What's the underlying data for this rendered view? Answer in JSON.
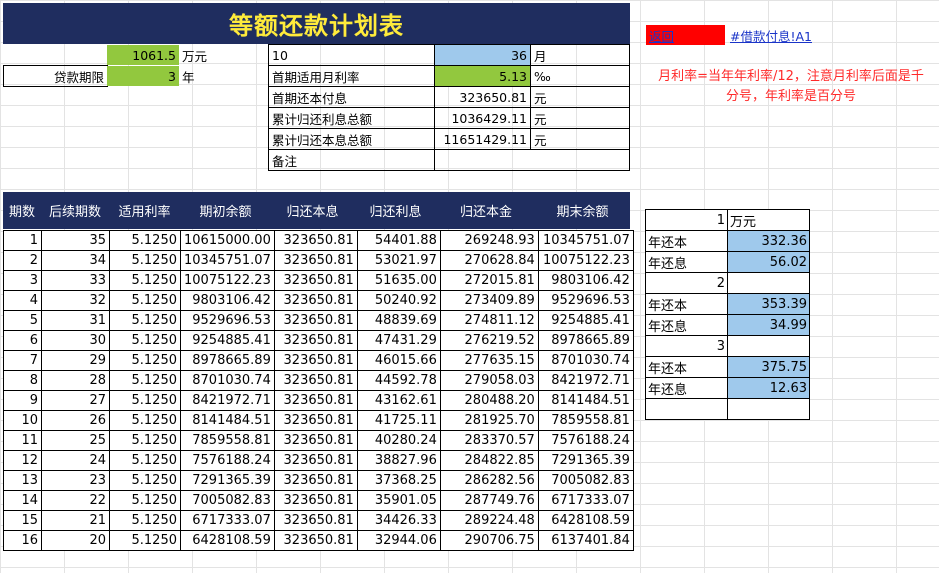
{
  "title": "等额还款计划表",
  "summary": {
    "loan_amount": "1061.5",
    "loan_unit": "万元",
    "term_label": "贷款期限",
    "term_value": "3",
    "term_unit": "年",
    "c10": "10",
    "months_value": "36",
    "months_unit": "月",
    "rate_label": "首期适用月利率",
    "rate_value": "5.13",
    "rate_unit": "‰",
    "first_payment_label": "首期还本付息",
    "first_payment_value": "323650.81",
    "yuan": "元",
    "cum_interest_label": "累计归还利息总额",
    "cum_interest_value": "1036429.11",
    "cum_total_label": "累计归还本息总额",
    "cum_total_value": "11651429.11",
    "remark_label": "备注"
  },
  "links": {
    "back_label": "返回",
    "sheet_link": "#借款付息!A1"
  },
  "note": {
    "line1": "月利率=当年年利率/12，注意月利率后面是千",
    "line2": "分号，年利率是百分号"
  },
  "table": {
    "headers": [
      "期数",
      "后续期数",
      "适用利率",
      "期初余额",
      "归还本息",
      "归还利息",
      "归还本金",
      "期末余额"
    ],
    "rows": [
      [
        "1",
        "35",
        "5.1250",
        "10615000.00",
        "323650.81",
        "54401.88",
        "269248.93",
        "10345751.07"
      ],
      [
        "2",
        "34",
        "5.1250",
        "10345751.07",
        "323650.81",
        "53021.97",
        "270628.84",
        "10075122.23"
      ],
      [
        "3",
        "33",
        "5.1250",
        "10075122.23",
        "323650.81",
        "51635.00",
        "272015.81",
        "9803106.42"
      ],
      [
        "4",
        "32",
        "5.1250",
        "9803106.42",
        "323650.81",
        "50240.92",
        "273409.89",
        "9529696.53"
      ],
      [
        "5",
        "31",
        "5.1250",
        "9529696.53",
        "323650.81",
        "48839.69",
        "274811.12",
        "9254885.41"
      ],
      [
        "6",
        "30",
        "5.1250",
        "9254885.41",
        "323650.81",
        "47431.29",
        "276219.52",
        "8978665.89"
      ],
      [
        "7",
        "29",
        "5.1250",
        "8978665.89",
        "323650.81",
        "46015.66",
        "277635.15",
        "8701030.74"
      ],
      [
        "8",
        "28",
        "5.1250",
        "8701030.74",
        "323650.81",
        "44592.78",
        "279058.03",
        "8421972.71"
      ],
      [
        "9",
        "27",
        "5.1250",
        "8421972.71",
        "323650.81",
        "43162.61",
        "280488.20",
        "8141484.51"
      ],
      [
        "10",
        "26",
        "5.1250",
        "8141484.51",
        "323650.81",
        "41725.11",
        "281925.70",
        "7859558.81"
      ],
      [
        "11",
        "25",
        "5.1250",
        "7859558.81",
        "323650.81",
        "40280.24",
        "283370.57",
        "7576188.24"
      ],
      [
        "12",
        "24",
        "5.1250",
        "7576188.24",
        "323650.81",
        "38827.96",
        "284822.85",
        "7291365.39"
      ],
      [
        "13",
        "23",
        "5.1250",
        "7291365.39",
        "323650.81",
        "37368.25",
        "286282.56",
        "7005082.83"
      ],
      [
        "14",
        "22",
        "5.1250",
        "7005082.83",
        "323650.81",
        "35901.05",
        "287749.76",
        "6717333.07"
      ],
      [
        "15",
        "21",
        "5.1250",
        "6717333.07",
        "323650.81",
        "34426.33",
        "289224.48",
        "6428108.59"
      ],
      [
        "16",
        "20",
        "5.1250",
        "6428108.59",
        "323650.81",
        "32944.06",
        "290706.75",
        "6137401.84"
      ]
    ]
  },
  "side": {
    "rows": [
      {
        "label": "",
        "value": "1",
        "unit": "万元",
        "blue": false
      },
      {
        "label": "年还本",
        "value": "332.36",
        "unit": "",
        "blue": true
      },
      {
        "label": "年还息",
        "value": "56.02",
        "unit": "",
        "blue": true
      },
      {
        "label": "",
        "value": "2",
        "unit": "",
        "blue": false
      },
      {
        "label": "年还本",
        "value": "353.39",
        "unit": "",
        "blue": true
      },
      {
        "label": "年还息",
        "value": "34.99",
        "unit": "",
        "blue": true
      },
      {
        "label": "",
        "value": "3",
        "unit": "",
        "blue": false
      },
      {
        "label": "年还本",
        "value": "375.75",
        "unit": "",
        "blue": true
      },
      {
        "label": "年还息",
        "value": "12.63",
        "unit": "",
        "blue": true
      },
      {
        "label": "",
        "value": "",
        "unit": "",
        "blue": false
      }
    ]
  }
}
